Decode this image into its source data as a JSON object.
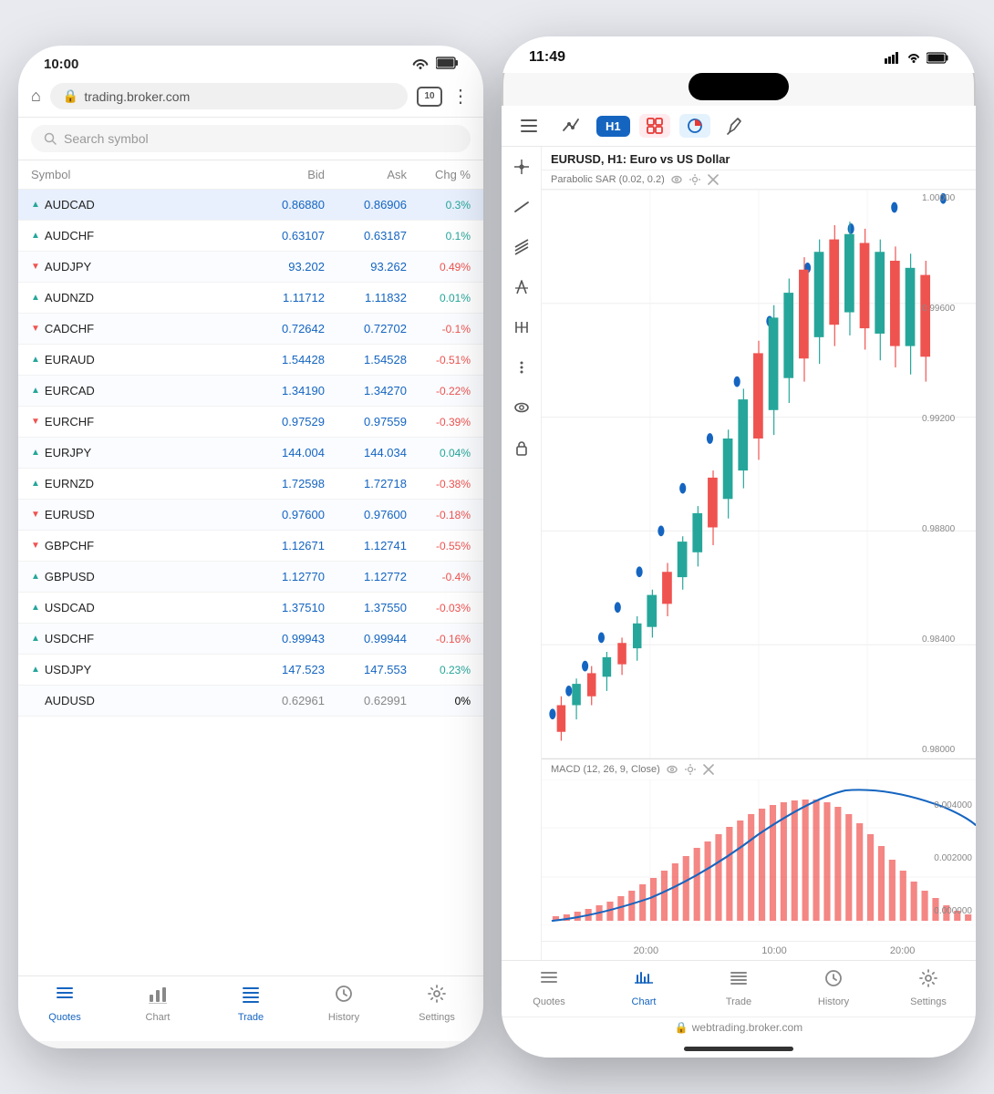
{
  "phone1": {
    "status": {
      "time": "10:00",
      "wifi_icon": "📶",
      "battery_icon": "🔋"
    },
    "browser": {
      "url": "trading.broker.com",
      "tab_count": "10",
      "lock_icon": "🔒"
    },
    "search": {
      "placeholder": "Search symbol"
    },
    "table": {
      "headers": [
        "Symbol",
        "Bid",
        "Ask",
        "Chg %"
      ],
      "rows": [
        {
          "symbol": "AUDCAD",
          "direction": "up",
          "bid": "0.86880",
          "ask": "0.86906",
          "chg": "0.3%",
          "chg_sign": "pos"
        },
        {
          "symbol": "AUDCHF",
          "direction": "up",
          "bid": "0.63107",
          "ask": "0.63187",
          "chg": "0.1%",
          "chg_sign": "pos"
        },
        {
          "symbol": "AUDJPY",
          "direction": "down",
          "bid": "93.202",
          "ask": "93.262",
          "chg": "0.49%",
          "chg_sign": "neg"
        },
        {
          "symbol": "AUDNZD",
          "direction": "up",
          "bid": "1.11712",
          "ask": "1.11832",
          "chg": "0.01%",
          "chg_sign": "pos"
        },
        {
          "symbol": "CADCHF",
          "direction": "down",
          "bid": "0.72642",
          "ask": "0.72702",
          "chg": "-0.1%",
          "chg_sign": "neg"
        },
        {
          "symbol": "EURAUD",
          "direction": "up",
          "bid": "1.54428",
          "ask": "1.54528",
          "chg": "-0.51%",
          "chg_sign": "neg"
        },
        {
          "symbol": "EURCAD",
          "direction": "up",
          "bid": "1.34190",
          "ask": "1.34270",
          "chg": "-0.22%",
          "chg_sign": "neg"
        },
        {
          "symbol": "EURCHF",
          "direction": "down",
          "bid": "0.97529",
          "ask": "0.97559",
          "chg": "-0.39%",
          "chg_sign": "neg"
        },
        {
          "symbol": "EURJPY",
          "direction": "up",
          "bid": "144.004",
          "ask": "144.034",
          "chg": "0.04%",
          "chg_sign": "pos"
        },
        {
          "symbol": "EURNZD",
          "direction": "up",
          "bid": "1.72598",
          "ask": "1.72718",
          "chg": "-0.38%",
          "chg_sign": "neg"
        },
        {
          "symbol": "EURUSD",
          "direction": "down",
          "bid": "0.97600",
          "ask": "0.97600",
          "chg": "-0.18%",
          "chg_sign": "neg"
        },
        {
          "symbol": "GBPCHF",
          "direction": "down",
          "bid": "1.12671",
          "ask": "1.12741",
          "chg": "-0.55%",
          "chg_sign": "neg"
        },
        {
          "symbol": "GBPUSD",
          "direction": "up",
          "bid": "1.12770",
          "ask": "1.12772",
          "chg": "-0.4%",
          "chg_sign": "neg"
        },
        {
          "symbol": "USDCAD",
          "direction": "up",
          "bid": "1.37510",
          "ask": "1.37550",
          "chg": "-0.03%",
          "chg_sign": "neg"
        },
        {
          "symbol": "USDCHF",
          "direction": "up",
          "bid": "0.99943",
          "ask": "0.99944",
          "chg": "-0.16%",
          "chg_sign": "neg"
        },
        {
          "symbol": "USDJPY",
          "direction": "up",
          "bid": "147.523",
          "ask": "147.553",
          "chg": "0.23%",
          "chg_sign": "pos"
        },
        {
          "symbol": "AUDUSD",
          "direction": "none",
          "bid": "0.62961",
          "ask": "0.62991",
          "chg": "0%",
          "chg_sign": "neutral"
        }
      ]
    },
    "nav": [
      {
        "id": "quotes",
        "label": "Quotes",
        "icon": "≡",
        "active": true
      },
      {
        "id": "chart",
        "label": "Chart",
        "icon": "📊",
        "active": false
      },
      {
        "id": "trade",
        "label": "Trade",
        "icon": "⇄",
        "active": false
      },
      {
        "id": "history",
        "label": "History",
        "icon": "🕐",
        "active": false
      },
      {
        "id": "settings",
        "label": "Settings",
        "icon": "⚙",
        "active": false
      }
    ]
  },
  "phone2": {
    "status": {
      "time": "11:49",
      "signal_icon": "...",
      "wifi_icon": "wifi",
      "battery_icon": "battery"
    },
    "toolbar": {
      "menu_icon": "☰",
      "indicators_icon": "⚡",
      "timeframe": "H1",
      "compare_icon": "⊞",
      "type_icon": "◑",
      "drawing_icon": "📐"
    },
    "chart": {
      "title": "EURUSD, H1: Euro vs US Dollar",
      "indicator": "Parabolic SAR (0.02, 0.2)",
      "price_levels": [
        "1.00000",
        "0.99600",
        "0.99200",
        "0.98800",
        "0.98400",
        "0.98000"
      ],
      "macd_label": "MACD (12, 26, 9, Close)",
      "macd_levels": [
        "0.004000",
        "0.002000",
        "0.000000"
      ],
      "time_labels": [
        "20:00",
        "10:00",
        "20:00"
      ]
    },
    "nav": [
      {
        "id": "quotes",
        "label": "Quotes",
        "icon": "≡",
        "active": false
      },
      {
        "id": "chart",
        "label": "Chart",
        "icon": "📊",
        "active": true
      },
      {
        "id": "trade",
        "label": "Trade",
        "icon": "⇄",
        "active": false
      },
      {
        "id": "history",
        "label": "History",
        "icon": "🕐",
        "active": false
      },
      {
        "id": "settings",
        "label": "Settings",
        "icon": "⚙",
        "active": false
      }
    ],
    "url": "webtrading.broker.com"
  }
}
